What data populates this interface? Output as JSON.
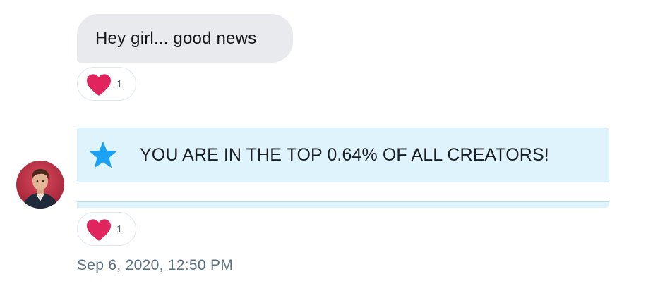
{
  "messages": [
    {
      "text": "Hey girl... good news",
      "reaction": {
        "icon": "heart-icon",
        "count": "1"
      }
    },
    {
      "card": {
        "icon": "star-icon",
        "text": "YOU ARE IN THE TOP 0.64% OF ALL CREATORS!"
      },
      "reaction": {
        "icon": "heart-icon",
        "count": "1"
      }
    }
  ],
  "timestamp": "Sep 6, 2020, 12:50 PM",
  "colors": {
    "bubble_bg": "#e8eaed",
    "card_bg": "#dff3fc",
    "star": "#1da1f2",
    "heart": "#e0245e",
    "timestamp": "#5b7083"
  }
}
